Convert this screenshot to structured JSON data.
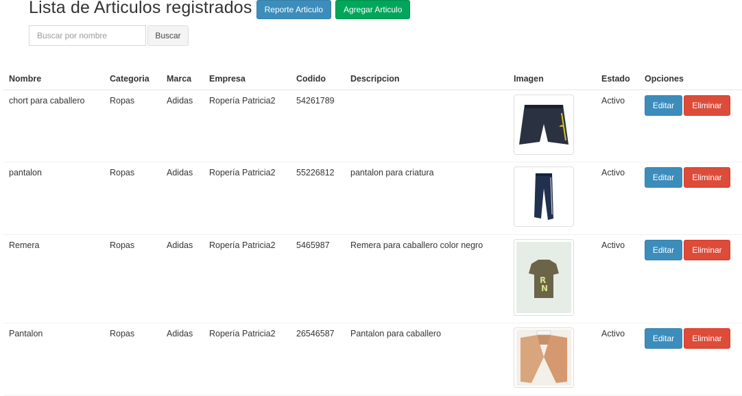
{
  "header": {
    "title": "Lista de Articulos registrados",
    "report_button": "Reporte Articulo",
    "add_button": "Agregar Articulo"
  },
  "search": {
    "placeholder": "Buscar por nombre",
    "value": "",
    "button": "Buscar"
  },
  "table": {
    "columns": [
      "Nombre",
      "Categoria",
      "Marca",
      "Empresa",
      "Codido",
      "Descripcion",
      "Imagen",
      "Estado",
      "Opciones"
    ],
    "rows": [
      {
        "nombre": "chort para caballero",
        "categoria": "Ropas",
        "marca": "Adidas",
        "empresa": "Ropería Patricia2",
        "codigo": "54261789",
        "descripcion": "",
        "imagen": "shorts-icon",
        "estado": "Activo"
      },
      {
        "nombre": "pantalon",
        "categoria": "Ropas",
        "marca": "Adidas",
        "empresa": "Ropería Patricia2",
        "codigo": "55226812",
        "descripcion": "pantalon para criatura",
        "imagen": "pants-icon",
        "estado": "Activo"
      },
      {
        "nombre": "Remera",
        "categoria": "Ropas",
        "marca": "Adidas",
        "empresa": "Ropería Patricia2",
        "codigo": "5465987",
        "descripcion": "Remera para caballero color negro",
        "imagen": "tshirt-icon",
        "estado": "Activo"
      },
      {
        "nombre": "Pantalon",
        "categoria": "Ropas",
        "marca": "Adidas",
        "empresa": "Ropería Patricia2",
        "codigo": "26546587",
        "descripcion": "Pantalon para caballero",
        "imagen": "beige-pants-icon",
        "estado": "Activo"
      }
    ],
    "edit_label": "Editar",
    "delete_label": "Eliminar"
  },
  "colors": {
    "primary": "#3c8dbc",
    "success": "#00a65a",
    "danger": "#dd4b39"
  }
}
